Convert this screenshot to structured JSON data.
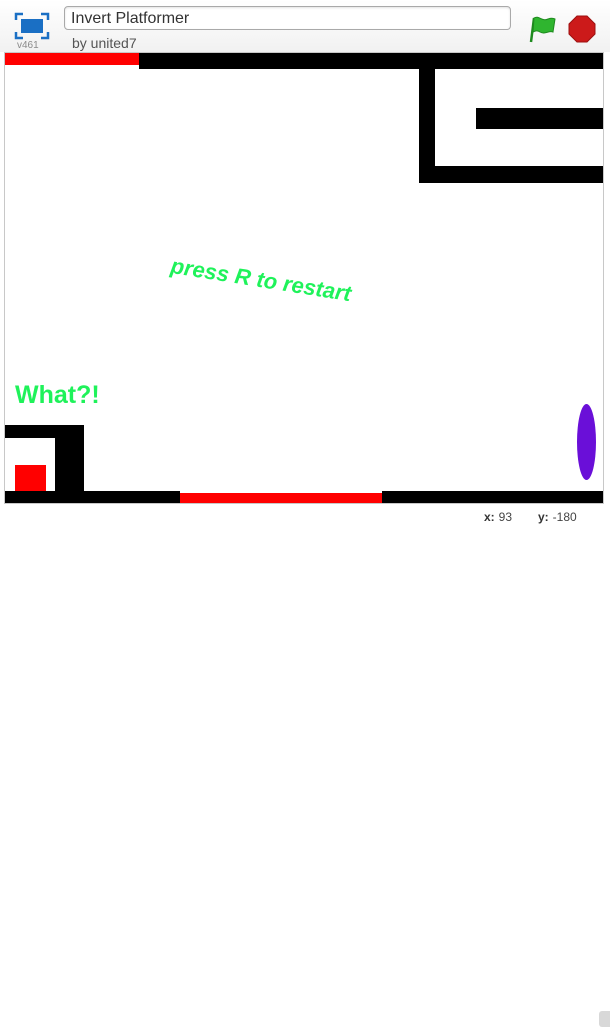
{
  "header": {
    "project_title": "Invert Platformer",
    "author_line": "by united7",
    "version": "v461"
  },
  "stage": {
    "restart_hint": "press R to restart",
    "exclaim": "What?!"
  },
  "status": {
    "x_label": "x:",
    "x_value": "93",
    "y_label": "y:",
    "y_value": "-180"
  },
  "colors": {
    "text_green": "#1ff25a",
    "hazard_red": "#ff0000",
    "portal_purple": "#6a0fd8",
    "flag_green": "#2fb52f",
    "stop_red": "#cc1a1a"
  },
  "icons": [
    "fullscreen-icon",
    "green-flag-icon",
    "stop-sign-icon"
  ]
}
